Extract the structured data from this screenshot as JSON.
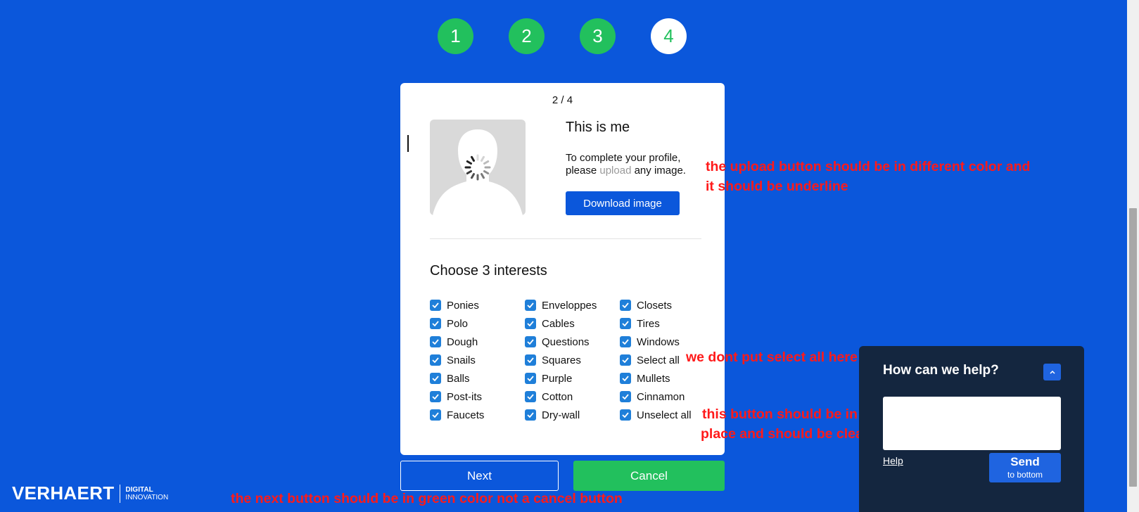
{
  "colors": {
    "background": "#0b57db",
    "accent_green": "#22c05d",
    "annotation_red": "#ff1a1a",
    "widget_bg": "#14263f"
  },
  "steps": [
    "1",
    "2",
    "3",
    "4"
  ],
  "card": {
    "pager": "2 / 4",
    "profile_title": "This is me",
    "profile_text_1": "To complete your profile, please ",
    "upload_link": "upload",
    "profile_text_2": " any image.",
    "download_button": "Download image",
    "interests_title": "Choose 3 interests",
    "interests": [
      [
        "Ponies",
        "Polo",
        "Dough",
        "Snails",
        "Balls",
        "Post-its",
        "Faucets"
      ],
      [
        "Enveloppes",
        "Cables",
        "Questions",
        "Squares",
        "Purple",
        "Cotton",
        "Dry-wall"
      ],
      [
        "Closets",
        "Tires",
        "Windows",
        "Select all",
        "Mullets",
        "Cinnamon",
        "Unselect all"
      ]
    ]
  },
  "buttons": {
    "next": "Next",
    "cancel": "Cancel"
  },
  "annotations": {
    "upload_line1": "the upload button should be in different color and",
    "upload_line2": "it should be underline",
    "select_all": "we dont put select all here",
    "unselect_line1": "this button should be in another",
    "unselect_line2": "place and should be clear",
    "next": "the next button should be in green color not a cancel button"
  },
  "logo": {
    "main": "VERHAERT",
    "sub1": "DIGITAL",
    "sub2": "INNOVATION"
  },
  "help_widget": {
    "title": "How can we help?",
    "toggle_icon": "chevron-up-icon",
    "input_value": "",
    "help_link": "Help",
    "send_label": "Send",
    "send_sublabel": "to bottom"
  }
}
